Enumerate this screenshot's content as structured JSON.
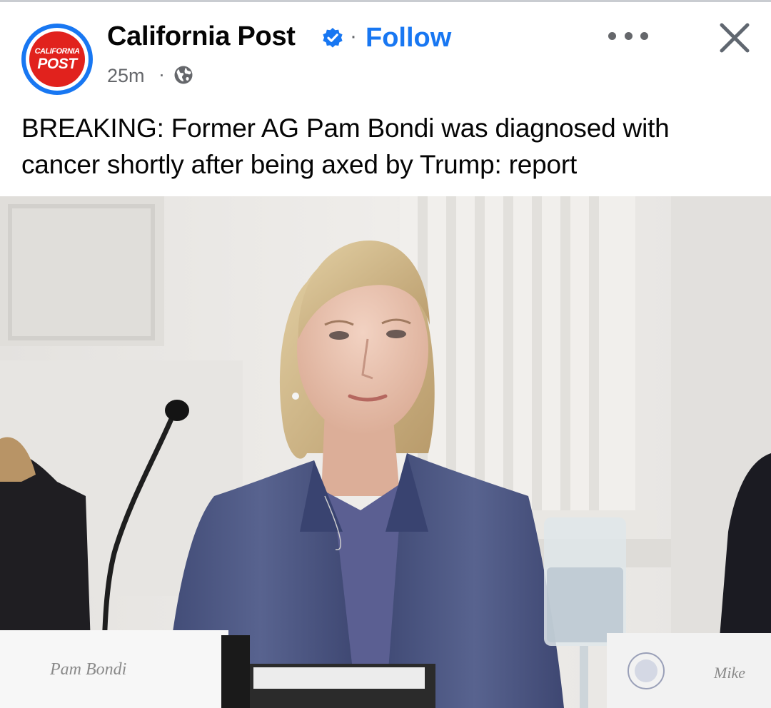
{
  "post": {
    "page_name": "California Post",
    "follow_label": "Follow",
    "time": "25m",
    "headline": "BREAKING: Former AG Pam Bondi was diagnosed with cancer shortly after being axed by Trump: report",
    "avatar": {
      "logo_top": "CALIFORNIA",
      "logo_bottom": "POST"
    },
    "icons": {
      "verified": "verified-badge-icon",
      "audience": "globe-icon",
      "more": "more-options-icon",
      "close": "close-icon"
    },
    "photo": {
      "placard_left": "Pam Bondi",
      "placard_right": "Mike"
    }
  },
  "colors": {
    "brand_blue": "#1877f2",
    "text_primary": "#050505",
    "text_secondary": "#65676b",
    "logo_red": "#e1221d"
  }
}
